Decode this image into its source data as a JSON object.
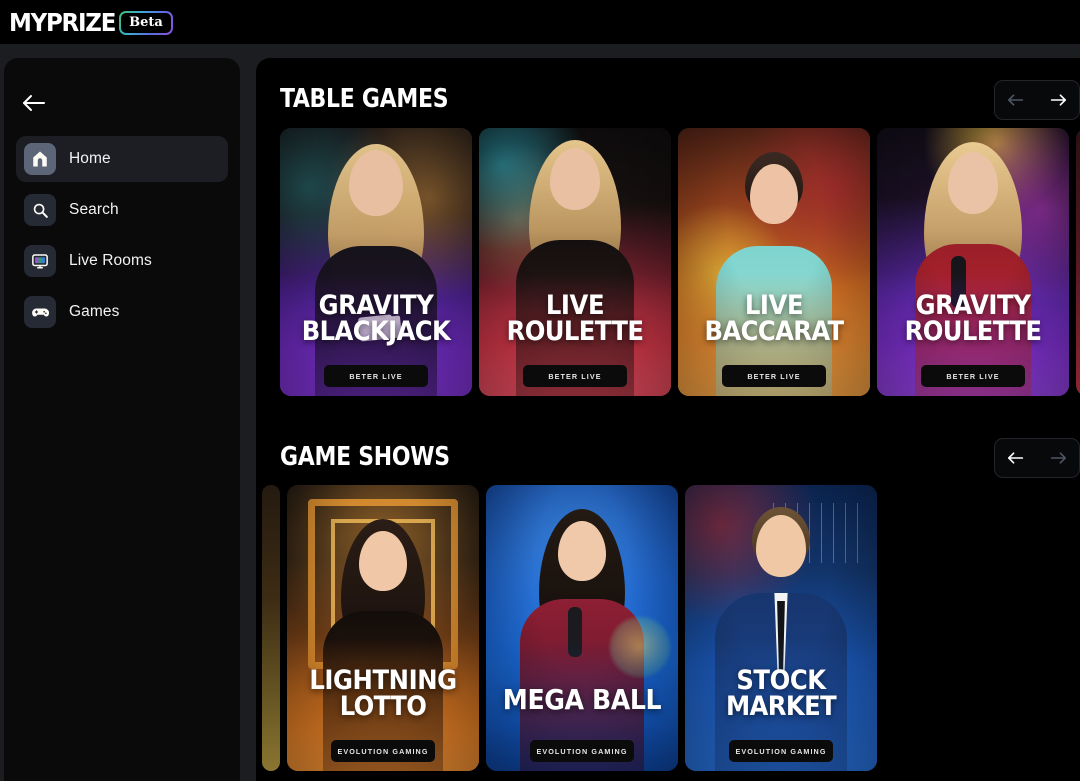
{
  "brand": {
    "logo_text": "MYPRIZE",
    "beta_label": "Beta"
  },
  "sidebar": {
    "back_icon": "arrow-left-icon",
    "items": [
      {
        "label": "Home",
        "icon": "home-icon",
        "active": true
      },
      {
        "label": "Search",
        "icon": "search-icon",
        "active": false
      },
      {
        "label": "Live Rooms",
        "icon": "monitor-icon",
        "active": false
      },
      {
        "label": "Games",
        "icon": "gamepad-icon",
        "active": false
      }
    ]
  },
  "sections": [
    {
      "title": "TABLE GAMES",
      "prev_enabled": false,
      "next_enabled": true,
      "prev_icon": "arrow-left-icon",
      "next_icon": "arrow-right-icon",
      "cards": [
        {
          "line1": "GRAVITY",
          "line2": "BLACKJACK",
          "provider": "BETER LIVE",
          "accent": "#7b2fd0"
        },
        {
          "line1": "LIVE",
          "line2": "ROULETTE",
          "provider": "BETER LIVE",
          "accent": "#e0384f"
        },
        {
          "line1": "LIVE",
          "line2": "BACCARAT",
          "provider": "BETER LIVE",
          "accent": "#f08a2a"
        },
        {
          "line1": "GRAVITY",
          "line2": "ROULETTE",
          "provider": "BETER LIVE",
          "accent": "#8432d6"
        }
      ]
    },
    {
      "title": "GAME SHOWS",
      "prev_enabled": true,
      "next_enabled": false,
      "prev_icon": "arrow-left-icon",
      "next_icon": "arrow-right-icon",
      "cards": [
        {
          "line1": "LIGHTNING",
          "line2": "LOTTO",
          "provider": "EVOLUTION GAMING",
          "accent": "#ef8324"
        },
        {
          "line1": "MEGA BALL",
          "line2": "",
          "provider": "EVOLUTION GAMING",
          "accent": "#1565d8"
        },
        {
          "line1": "STOCK",
          "line2": "MARKET",
          "provider": "EVOLUTION GAMING",
          "accent": "#1a5fd0"
        }
      ]
    }
  ],
  "colors": {
    "page_bg": "#1b1d21",
    "panel_bg": "#000000",
    "sidebar_bg": "#0a0a0b",
    "active_nav_bg": "#1c1e24",
    "icon_tile": "#252a35",
    "icon_tile_active": "#5d6678",
    "text_primary": "#ffffff",
    "arrow_disabled": "#4e5564"
  }
}
